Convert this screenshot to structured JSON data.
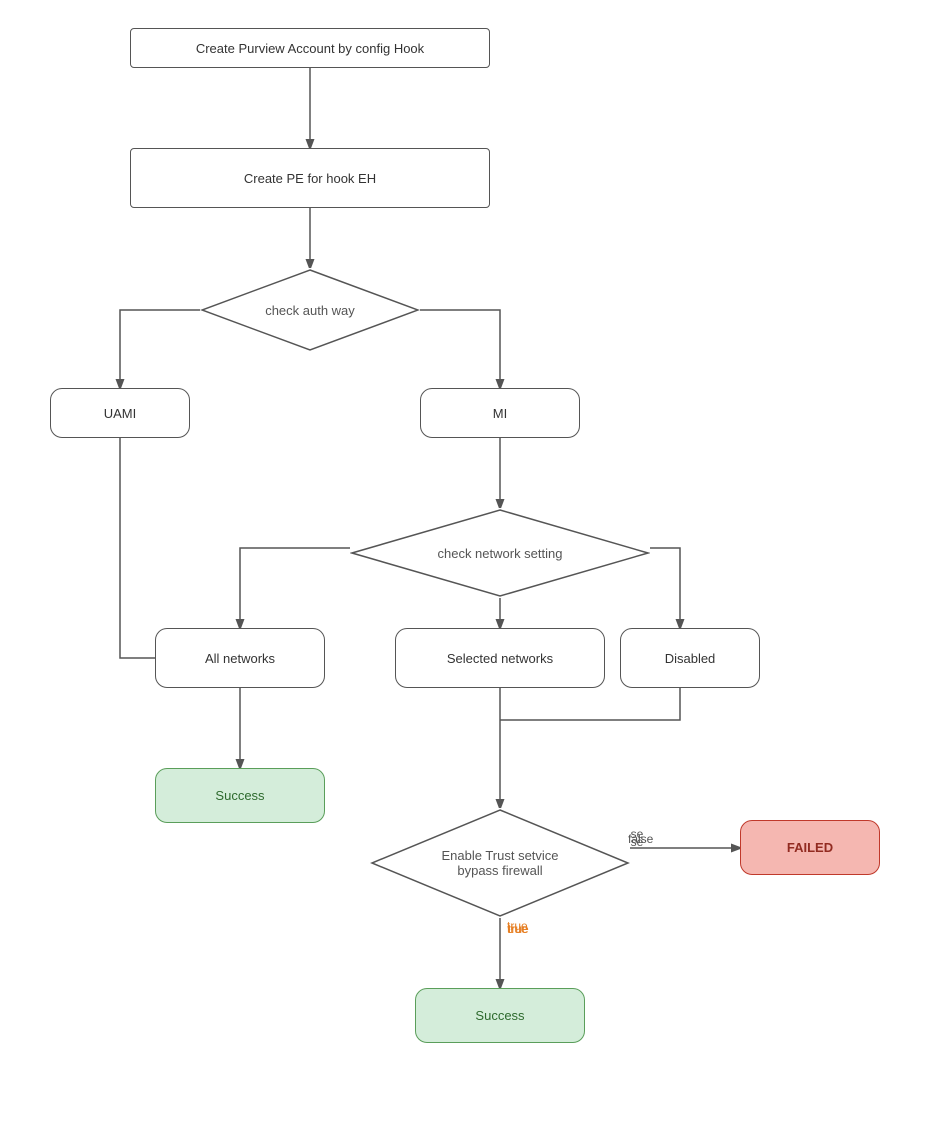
{
  "nodes": {
    "create_purview": {
      "label": "Create Purview Account by config Hook",
      "type": "rect"
    },
    "create_pe": {
      "label": "Create PE for hook EH",
      "type": "rect"
    },
    "check_auth": {
      "label": "check auth way",
      "type": "diamond"
    },
    "uami": {
      "label": "UAMI",
      "type": "rounded"
    },
    "mi": {
      "label": "MI",
      "type": "rounded"
    },
    "check_network": {
      "label": "check network setting",
      "type": "diamond"
    },
    "all_networks": {
      "label": "All networks",
      "type": "rounded"
    },
    "selected_networks": {
      "label": "Selected networks",
      "type": "rounded"
    },
    "disabled": {
      "label": "Disabled",
      "type": "rounded"
    },
    "success1": {
      "label": "Success",
      "type": "success"
    },
    "enable_trust": {
      "label": "Enable Trust setvice\nbypass firewall",
      "type": "diamond"
    },
    "failed": {
      "label": "FAILED",
      "type": "failed"
    },
    "success2": {
      "label": "Success",
      "type": "success"
    }
  },
  "labels": {
    "false": "false",
    "true": "true"
  }
}
